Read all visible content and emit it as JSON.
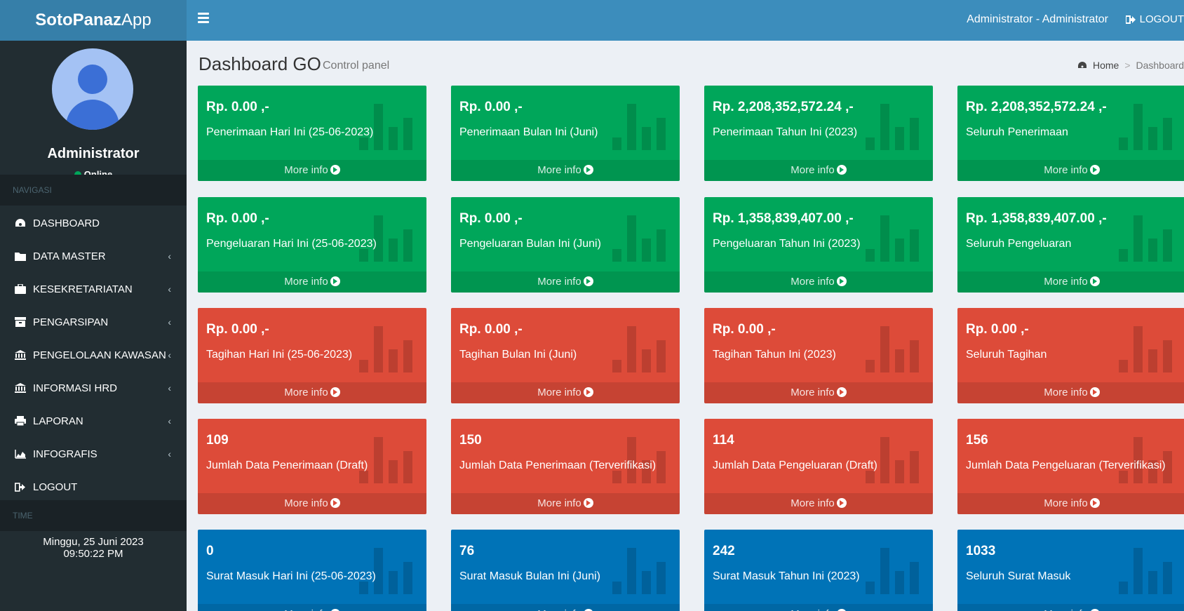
{
  "app": {
    "brand_bold": "SotoPanaz",
    "brand_light": "App"
  },
  "topbar": {
    "user": "Administrator - Administrator",
    "logout": "LOGOUT"
  },
  "sidebar": {
    "user_name": "Administrator",
    "status": "Online",
    "nav_header": "NAVIGASI",
    "items": [
      {
        "label": "DASHBOARD",
        "icon": "dashboard-icon",
        "chevron": false
      },
      {
        "label": "DATA MASTER",
        "icon": "folder-icon",
        "chevron": true
      },
      {
        "label": "KESEKRETARIATAN",
        "icon": "briefcase-icon",
        "chevron": true
      },
      {
        "label": "PENGARSIPAN",
        "icon": "archive-icon",
        "chevron": true
      },
      {
        "label": "PENGELOLAAN KAWASAN",
        "icon": "institution-icon",
        "chevron": true
      },
      {
        "label": "INFORMASI HRD",
        "icon": "institution-icon",
        "chevron": true
      },
      {
        "label": "LAPORAN",
        "icon": "print-icon",
        "chevron": true
      },
      {
        "label": "INFOGRAFIS",
        "icon": "area-chart-icon",
        "chevron": true
      },
      {
        "label": "LOGOUT",
        "icon": "sign-out-icon",
        "chevron": false
      }
    ],
    "time_header": "TIME",
    "date": "Minggu, 25 Juni 2023",
    "time": "09:50:22 PM"
  },
  "page": {
    "title": "Dashboard GO",
    "subtitle": "Control panel",
    "breadcrumb": {
      "home": "Home",
      "separator": ">",
      "current": "Dashboard"
    }
  },
  "more_info": "More info",
  "colors": {
    "green": "#00a65a",
    "red": "#dd4b39",
    "blue": "#0073b7",
    "header": "#3c8dbc",
    "sidebar": "#222d32"
  },
  "rows": [
    {
      "color": "green",
      "boxes": [
        {
          "value": "Rp. 0.00 ,-",
          "label": "Penerimaan Hari Ini (25-06-2023)"
        },
        {
          "value": "Rp. 0.00 ,-",
          "label": "Penerimaan Bulan Ini (Juni)"
        },
        {
          "value": "Rp. 2,208,352,572.24 ,-",
          "label": "Penerimaan Tahun Ini (2023)"
        },
        {
          "value": "Rp. 2,208,352,572.24 ,-",
          "label": "Seluruh Penerimaan"
        }
      ]
    },
    {
      "color": "green",
      "boxes": [
        {
          "value": "Rp. 0.00 ,-",
          "label": "Pengeluaran Hari Ini (25-06-2023)"
        },
        {
          "value": "Rp. 0.00 ,-",
          "label": "Pengeluaran Bulan Ini (Juni)"
        },
        {
          "value": "Rp. 1,358,839,407.00 ,-",
          "label": "Pengeluaran Tahun Ini (2023)"
        },
        {
          "value": "Rp. 1,358,839,407.00 ,-",
          "label": "Seluruh Pengeluaran"
        }
      ]
    },
    {
      "color": "red",
      "boxes": [
        {
          "value": "Rp. 0.00 ,-",
          "label": "Tagihan Hari Ini (25-06-2023)"
        },
        {
          "value": "Rp. 0.00 ,-",
          "label": "Tagihan Bulan Ini (Juni)"
        },
        {
          "value": "Rp. 0.00 ,-",
          "label": "Tagihan Tahun Ini (2023)"
        },
        {
          "value": "Rp. 0.00 ,-",
          "label": "Seluruh Tagihan"
        }
      ]
    },
    {
      "color": "red",
      "boxes": [
        {
          "value": "109",
          "label": "Jumlah Data Penerimaan (Draft)"
        },
        {
          "value": "150",
          "label": "Jumlah Data Penerimaan (Terverifikasi)"
        },
        {
          "value": "114",
          "label": "Jumlah Data Pengeluaran (Draft)"
        },
        {
          "value": "156",
          "label": "Jumlah Data Pengeluaran (Terverifikasi)"
        }
      ]
    },
    {
      "color": "blue",
      "boxes": [
        {
          "value": "0",
          "label": "Surat Masuk Hari Ini (25-06-2023)"
        },
        {
          "value": "76",
          "label": "Surat Masuk Bulan Ini (Juni)"
        },
        {
          "value": "242",
          "label": "Surat Masuk Tahun Ini (2023)"
        },
        {
          "value": "1033",
          "label": "Seluruh Surat Masuk"
        }
      ]
    }
  ]
}
